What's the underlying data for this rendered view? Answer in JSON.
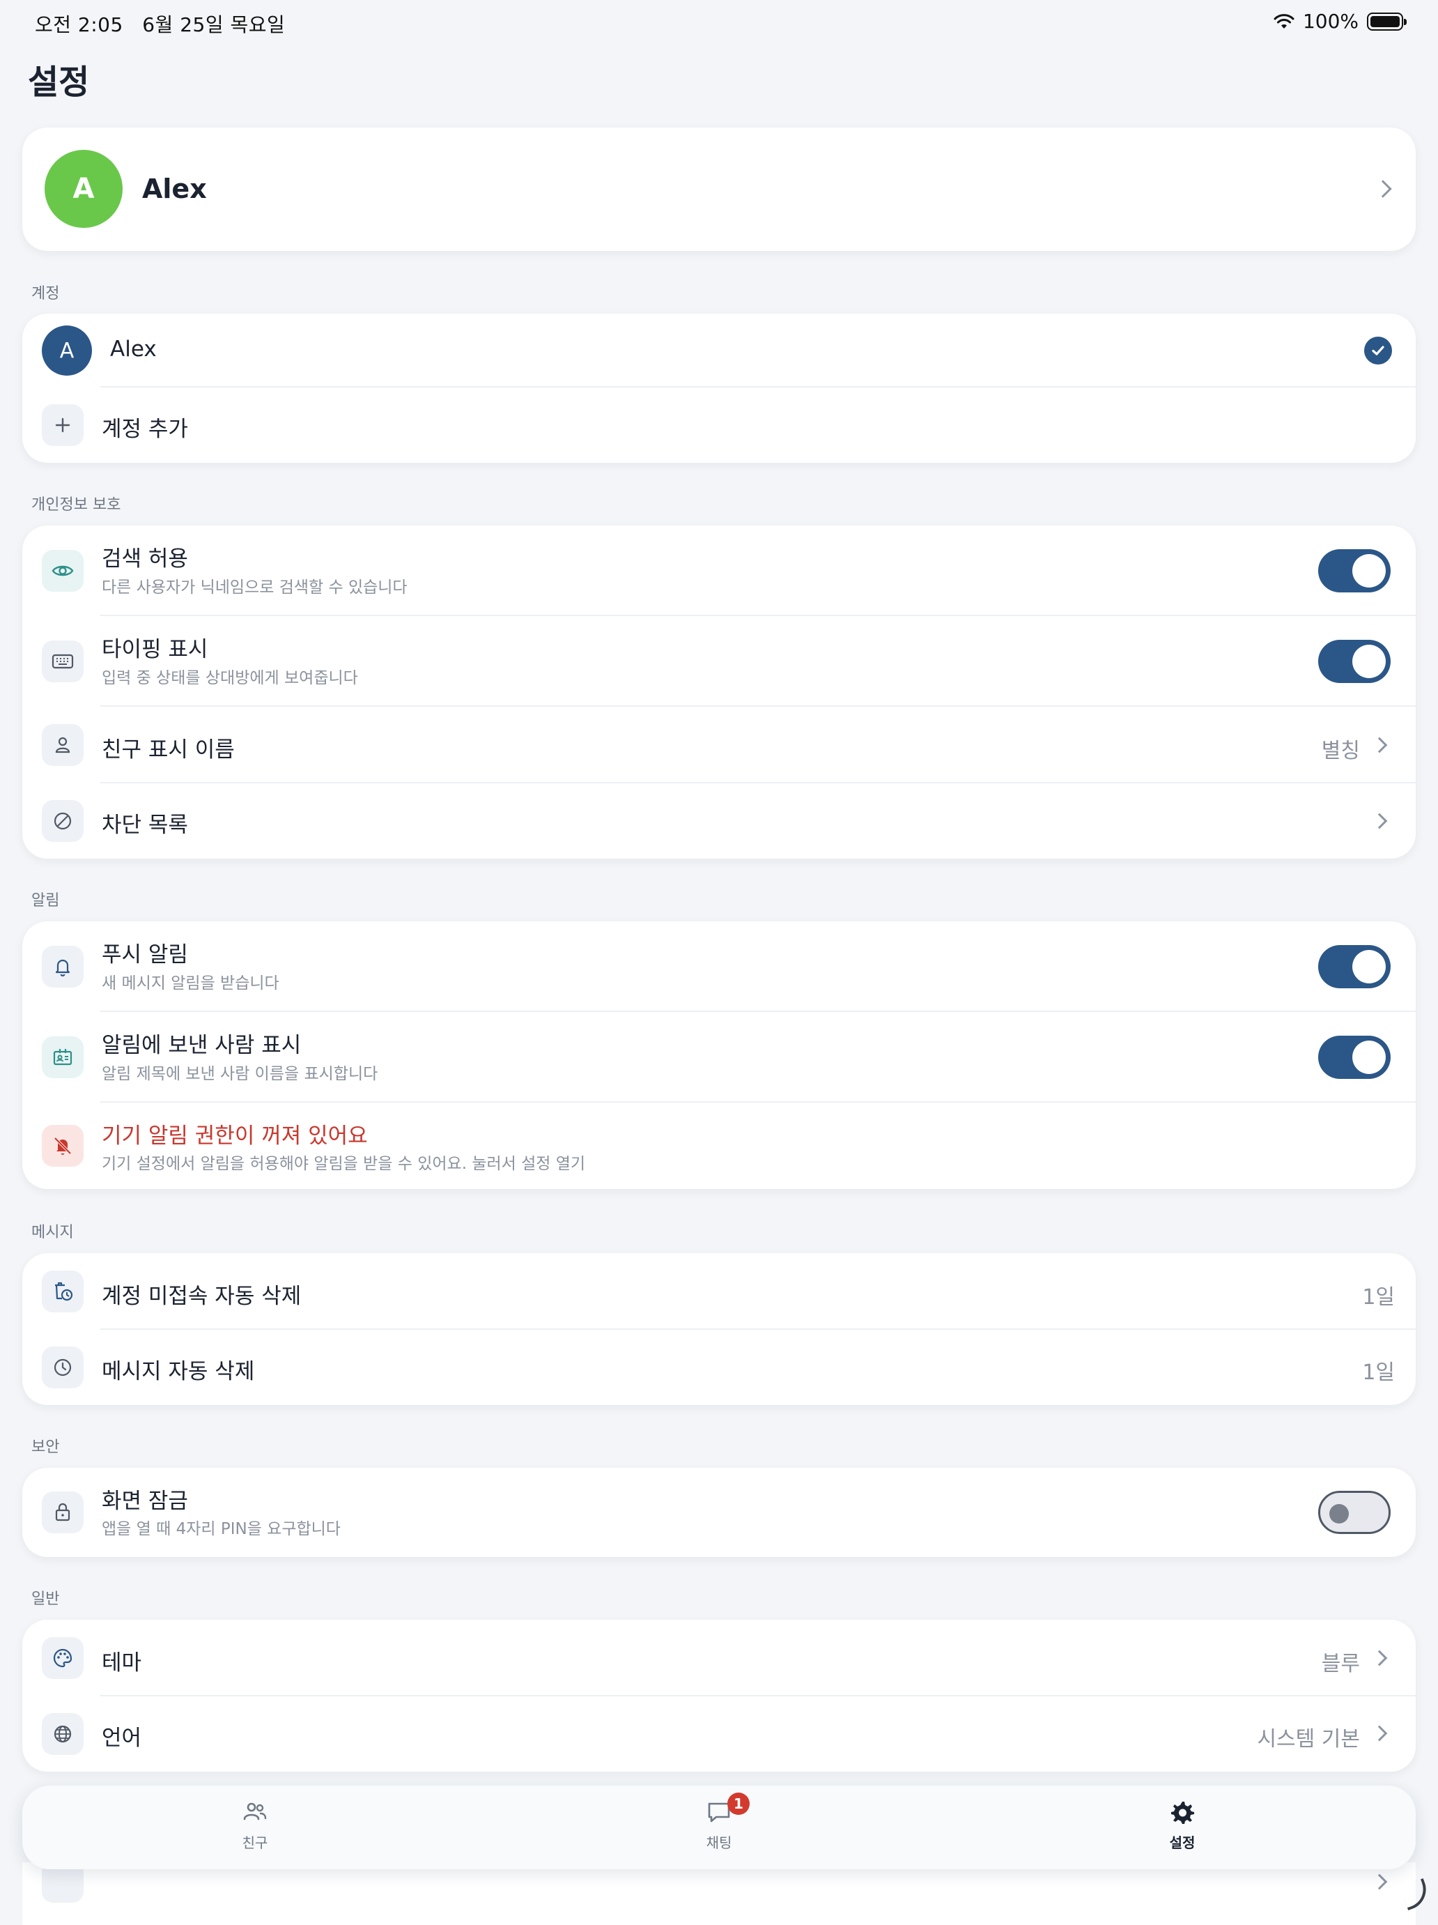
{
  "status_bar": {
    "time": "오전 2:05",
    "date": "6월 25일 목요일",
    "battery": "100%"
  },
  "page_title": "설정",
  "profile": {
    "avatar_letter": "A",
    "name": "Alex",
    "avatar_color": "#69c84a"
  },
  "sections": {
    "account": {
      "label": "계정",
      "current_account": {
        "avatar_letter": "A",
        "name": "Alex",
        "selected": true
      },
      "add_account": "계정 추가"
    },
    "privacy": {
      "label": "개인정보 보호",
      "search_allow": {
        "title": "검색 허용",
        "subtitle": "다른 사용자가 닉네임으로 검색할 수 있습니다",
        "enabled": true,
        "icon": "eye-icon"
      },
      "typing_indicator": {
        "title": "타이핑 표시",
        "subtitle": "입력 중 상태를 상대방에게 보여줍니다",
        "enabled": true,
        "icon": "keyboard-icon"
      },
      "friend_display_name": {
        "title": "친구 표시 이름",
        "value": "별칭",
        "icon": "person-icon"
      },
      "block_list": {
        "title": "차단 목록",
        "icon": "block-icon"
      }
    },
    "notifications": {
      "label": "알림",
      "push": {
        "title": "푸시 알림",
        "subtitle": "새 메시지 알림을 받습니다",
        "enabled": true,
        "icon": "bell-icon"
      },
      "show_sender": {
        "title": "알림에 보낸 사람 표시",
        "subtitle": "알림 제목에 보낸 사람 이름을 표시합니다",
        "enabled": true,
        "icon": "contact-card-icon"
      },
      "permission_warning": {
        "title": "기기 알림 권한이 꺼져 있어요",
        "subtitle": "기기 설정에서 알림을 허용해야 알림을 받을 수 있어요. 눌러서 설정 열기",
        "icon": "bell-off-icon",
        "color": "#c8372d"
      }
    },
    "messages": {
      "label": "메시지",
      "inactive_delete": {
        "title": "계정 미접속 자동 삭제",
        "value": "1일",
        "icon": "trash-clock-icon"
      },
      "message_auto_delete": {
        "title": "메시지 자동 삭제",
        "value": "1일",
        "icon": "clock-icon"
      }
    },
    "security": {
      "label": "보안",
      "screen_lock": {
        "title": "화면 잠금",
        "subtitle": "앱을 열 때 4자리 PIN을 요구합니다",
        "enabled": false,
        "icon": "lock-icon"
      }
    },
    "general": {
      "label": "일반",
      "theme": {
        "title": "테마",
        "value": "블루",
        "icon": "palette-icon"
      },
      "language": {
        "title": "언어",
        "value": "시스템 기본",
        "icon": "globe-icon"
      }
    }
  },
  "tab_bar": {
    "friends": {
      "label": "친구",
      "icon": "friends-icon"
    },
    "chat": {
      "label": "채팅",
      "icon": "chat-icon",
      "badge": "1"
    },
    "settings": {
      "label": "설정",
      "icon": "gear-icon",
      "active": true
    }
  },
  "colors": {
    "accent": "#2b5688",
    "background": "#f3f5f8",
    "warning": "#c8372d",
    "badge": "#d23a2e"
  }
}
